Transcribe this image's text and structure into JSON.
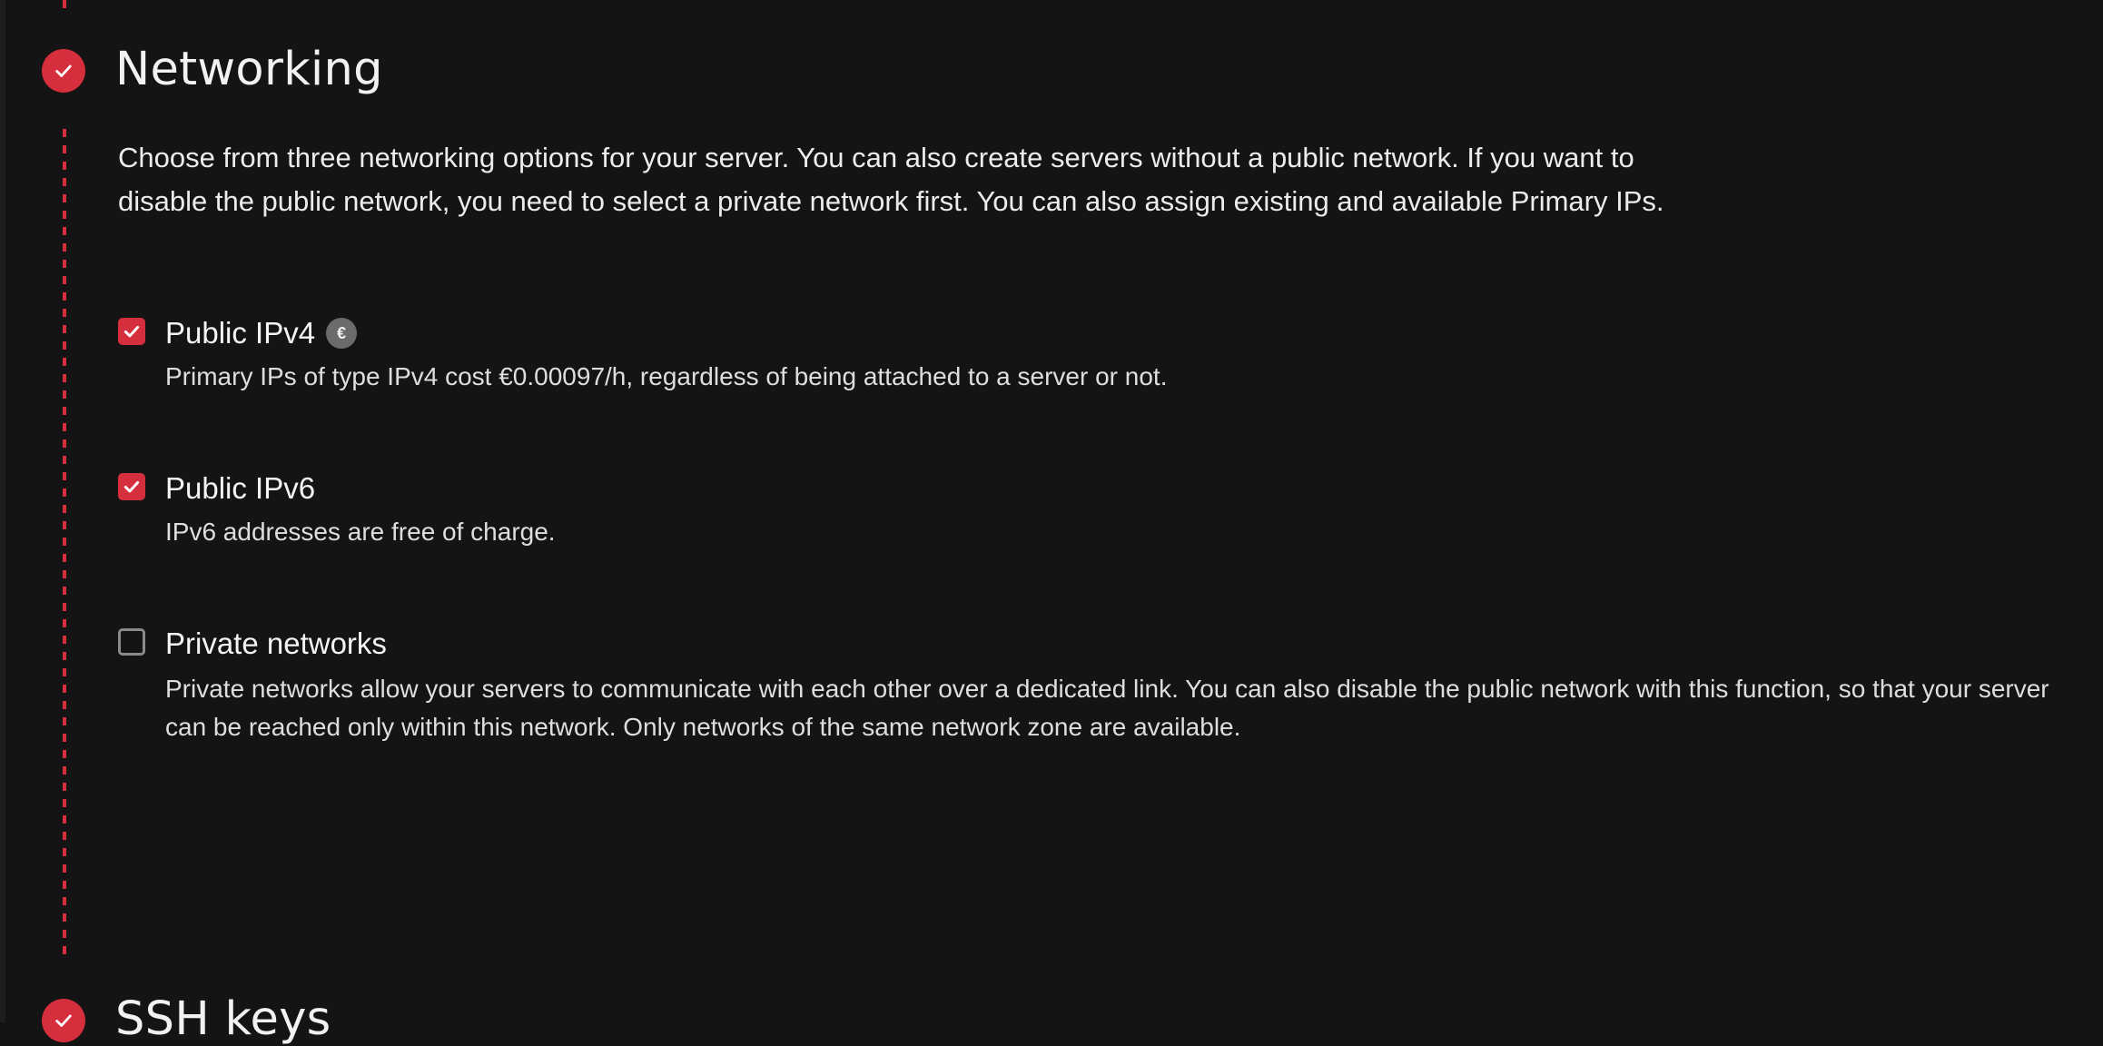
{
  "sections": {
    "networking": {
      "title": "Networking",
      "description": "Choose from three networking options for your server. You can also create servers without a public network. If you want to disable the public network, you need to select a private network first. You can also assign existing and available Primary IPs.",
      "options": [
        {
          "label": "Public IPv4",
          "checked": true,
          "badge": "€",
          "description": "Primary IPs of type IPv4 cost €0.00097/h, regardless of being attached to a server or not."
        },
        {
          "label": "Public IPv6",
          "checked": true,
          "description": "IPv6 addresses are free of charge."
        },
        {
          "label": "Private networks",
          "checked": false,
          "description": "Private networks allow your servers to communicate with each other over a dedicated link. You can also disable the public network with this function, so that your server can be reached only within this network. Only networks of the same network zone are available."
        }
      ]
    },
    "ssh_keys": {
      "title": "SSH keys"
    }
  },
  "colors": {
    "accent": "#d52f3d",
    "background": "#141414",
    "text": "#ececec",
    "badge": "#6b6b6b"
  },
  "icons": {
    "step_complete": "check-circle-icon",
    "checkbox_checked": "check-icon",
    "price_badge": "euro-icon"
  }
}
